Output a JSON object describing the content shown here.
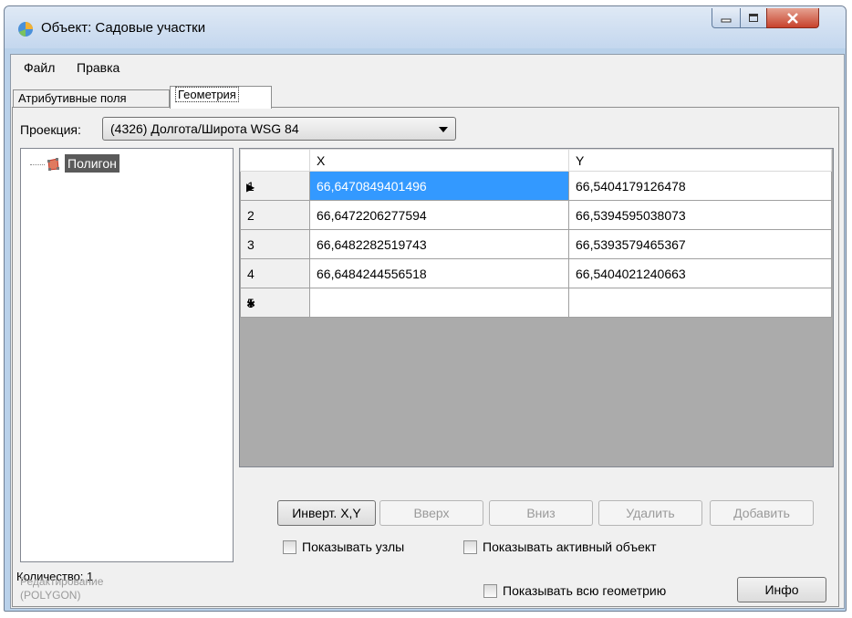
{
  "window": {
    "title": "Объект: Садовые участки"
  },
  "menu": {
    "items": [
      "Файл",
      "Правка"
    ]
  },
  "tabs": [
    {
      "label": "Атрибутивные поля",
      "active": false
    },
    {
      "label": "Геометрия",
      "active": true
    }
  ],
  "projection": {
    "label": "Проекция:",
    "value": "(4326) Долгота/Широта WSG 84"
  },
  "tree": {
    "node_label": "Полигон"
  },
  "count_label": "Количество: 1",
  "grid": {
    "columns": [
      "X",
      "Y"
    ],
    "rows": [
      {
        "num": "1",
        "x": "66,6470849401496",
        "y": "66,5404179126478",
        "marker": "▶"
      },
      {
        "num": "2",
        "x": "66,6472206277594",
        "y": "66,5394595038073",
        "marker": ""
      },
      {
        "num": "3",
        "x": "66,6482282519743",
        "y": "66,5393579465367",
        "marker": ""
      },
      {
        "num": "4",
        "x": "66,6484244556518",
        "y": "66,5404021240663",
        "marker": ""
      },
      {
        "num": "5",
        "x": "",
        "y": "",
        "marker": "✱"
      }
    ]
  },
  "buttons": {
    "invert": "Инверт. X,Y",
    "up": "Вверх",
    "down": "Вниз",
    "delete": "Удалить",
    "add": "Добавить",
    "info": "Инфо"
  },
  "checkboxes": {
    "show_nodes": "Показывать узлы",
    "show_active": "Показывать активный объект",
    "show_all": "Показывать всю геометрию"
  },
  "mode": {
    "line1": "Редактирование",
    "line2": "(POLYGON)"
  },
  "colors": {
    "selection": "#3399ff",
    "titlebar": "#c4d7ee",
    "close": "#c7422c"
  }
}
